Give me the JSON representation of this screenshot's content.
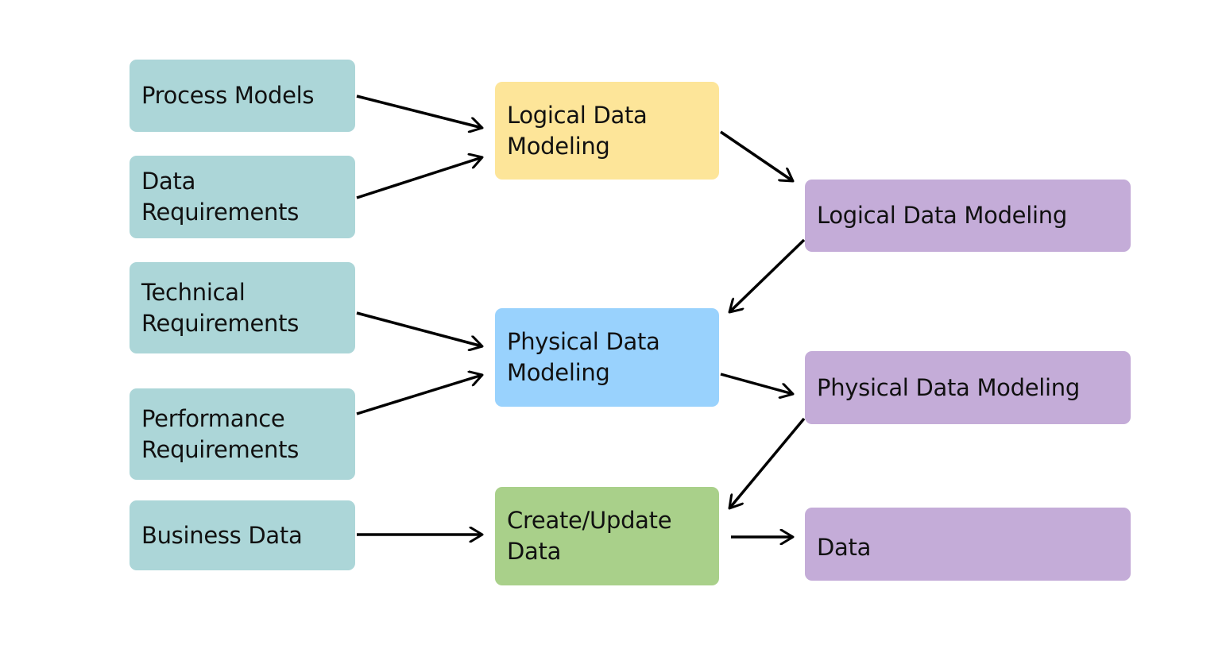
{
  "diagram": {
    "inputs": [
      {
        "id": "process-models",
        "label": "Process Models"
      },
      {
        "id": "data-requirements",
        "label": "Data\nRequirements"
      },
      {
        "id": "technical-requirements",
        "label": "Technical\nRequirements"
      },
      {
        "id": "performance-requirements",
        "label": "Performance\nRequirements"
      },
      {
        "id": "business-data",
        "label": "Business Data"
      }
    ],
    "processes": [
      {
        "id": "logical-data-modeling-process",
        "label": "Logical Data\nModeling",
        "color": "#fde599"
      },
      {
        "id": "physical-data-modeling-process",
        "label": "Physical Data\nModeling",
        "color": "#99d2fd"
      },
      {
        "id": "create-update-data-process",
        "label": "Create/Update\nData",
        "color": "#a9d08a"
      }
    ],
    "outputs": [
      {
        "id": "logical-data-modeling-output",
        "label": "Logical Data Modeling"
      },
      {
        "id": "physical-data-modeling-output",
        "label": "Physical Data Modeling"
      },
      {
        "id": "data-output",
        "label": "Data"
      }
    ],
    "colors": {
      "input": "#acd6d8",
      "output": "#c4acd8",
      "arrow": "#000000"
    },
    "edges": [
      {
        "from": "process-models",
        "to": "logical-data-modeling-process"
      },
      {
        "from": "data-requirements",
        "to": "logical-data-modeling-process"
      },
      {
        "from": "logical-data-modeling-process",
        "to": "logical-data-modeling-output"
      },
      {
        "from": "logical-data-modeling-output",
        "to": "physical-data-modeling-process"
      },
      {
        "from": "technical-requirements",
        "to": "physical-data-modeling-process"
      },
      {
        "from": "performance-requirements",
        "to": "physical-data-modeling-process"
      },
      {
        "from": "physical-data-modeling-process",
        "to": "physical-data-modeling-output"
      },
      {
        "from": "physical-data-modeling-output",
        "to": "create-update-data-process"
      },
      {
        "from": "business-data",
        "to": "create-update-data-process"
      },
      {
        "from": "create-update-data-process",
        "to": "data-output"
      }
    ]
  }
}
